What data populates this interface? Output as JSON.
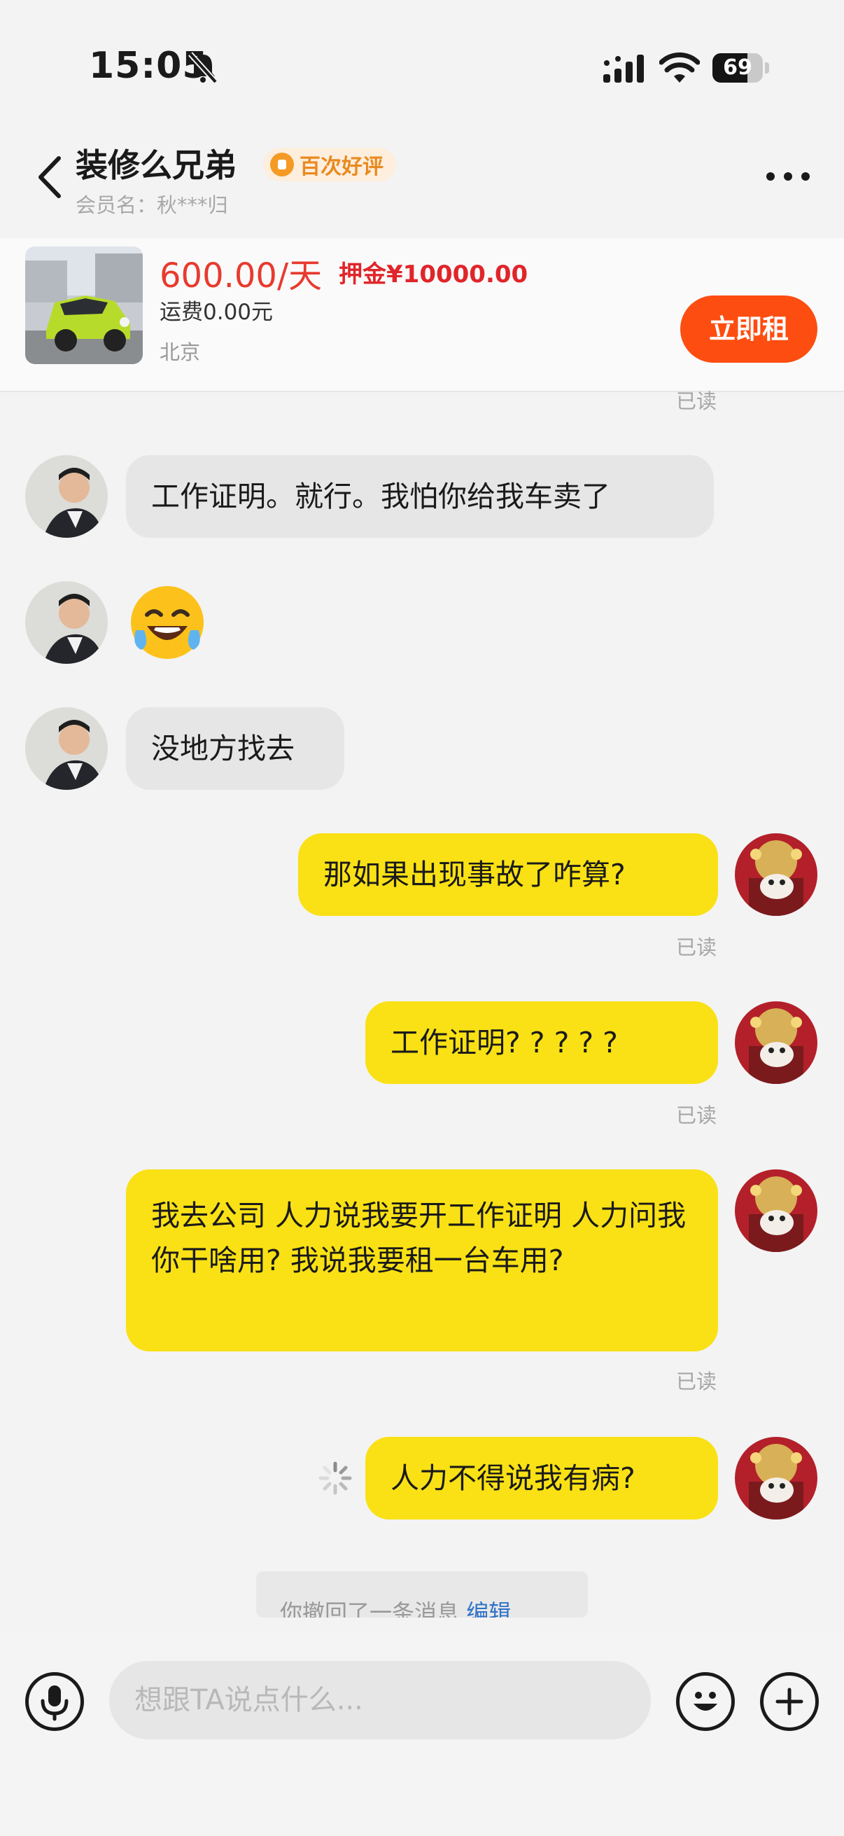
{
  "status_bar": {
    "time": "15:05",
    "battery": "69",
    "battery_level": 0.69
  },
  "header": {
    "title": "装修么兄弟",
    "badge": "百次好评",
    "member": "会员名：秋***归"
  },
  "product": {
    "price": "600.00/天",
    "deposit": "押金¥10000.00",
    "shipping": "运费0.00元",
    "location": "北京",
    "rent_button": "立即租"
  },
  "chat": {
    "top_read": "已读",
    "messages": [
      {
        "side": "in",
        "text": "工作证明。就行。我怕你给我车卖了"
      },
      {
        "side": "in",
        "text": "😂"
      },
      {
        "side": "in",
        "text": "没地方找去"
      },
      {
        "side": "out",
        "text": "那如果出现事故了咋算?",
        "status": "已读"
      },
      {
        "side": "out",
        "text": "工作证明? ? ? ? ?",
        "status": "已读"
      },
      {
        "side": "out",
        "text": "我去公司 人力说我要开工作证明 人力问我 你干啥用? 我说我要租一台车用?",
        "status": "已读"
      },
      {
        "side": "out",
        "text": "人力不得说我有病?",
        "status": "sending"
      }
    ],
    "recall_notice": "你撤回了一条消息",
    "recall_edit": "编辑"
  },
  "input": {
    "placeholder": "想跟TA说点什么..."
  },
  "colors": {
    "accent": "#fe4d10",
    "price": "#e83a2e",
    "bubble_out": "#f9e115",
    "bubble_in": "#e6e6e6"
  }
}
